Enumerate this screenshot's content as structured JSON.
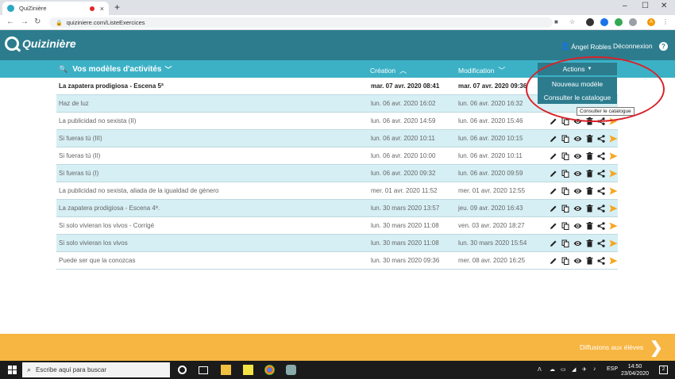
{
  "browser": {
    "tab_title": "QuiZinière",
    "tab_close": "×",
    "new_tab": "+",
    "window_controls": [
      "–",
      "☐",
      "✕"
    ],
    "url": "quiziniere.com/ListeExercices",
    "profile_initial": "A"
  },
  "app": {
    "logo_text": "Quizinière",
    "user_name": "Ángel Robles",
    "logout_label": "Déconnexion",
    "help_label": "?"
  },
  "table": {
    "title": "Vos modèles d'activités",
    "col_creation": "Création",
    "col_modification": "Modification",
    "actions_label": "Actions",
    "rows": [
      {
        "title": "La zapatera prodigiosa - Escena 5ª",
        "created": "mar. 07 avr. 2020 08:41",
        "modified": "mar. 07 avr. 2020 09:36"
      },
      {
        "title": "Haz de luz",
        "created": "lun. 06 avr. 2020 16:02",
        "modified": "lun. 06 avr. 2020 16:32"
      },
      {
        "title": "La publicidad no sexista (II)",
        "created": "lun. 06 avr. 2020 14:59",
        "modified": "lun. 06 avr. 2020 15:46"
      },
      {
        "title": "Si fueras tú (III)",
        "created": "lun. 06 avr. 2020 10:11",
        "modified": "lun. 06 avr. 2020 10:15"
      },
      {
        "title": "Si fueras tú (II)",
        "created": "lun. 06 avr. 2020 10:00",
        "modified": "lun. 06 avr. 2020 10:11"
      },
      {
        "title": "Si fueras tú (I)",
        "created": "lun. 06 avr. 2020 09:32",
        "modified": "lun. 06 avr. 2020 09:59"
      },
      {
        "title": "La publicidad no sexista, aliada de la igualdad de género",
        "created": "mer. 01 avr. 2020 11:52",
        "modified": "mer. 01 avr. 2020 12:55"
      },
      {
        "title": "La zapatera prodigiosa - Escena 4ª.",
        "created": "lun. 30 mars 2020 13:57",
        "modified": "jeu. 09 avr. 2020 16:43"
      },
      {
        "title": "Si solo vivieran los vivos - Corrigé",
        "created": "lun. 30 mars 2020 11:08",
        "modified": "ven. 03 avr. 2020 18:27"
      },
      {
        "title": "Si solo vivieran los vivos",
        "created": "lun. 30 mars 2020 11:08",
        "modified": "lun. 30 mars 2020 15:54"
      },
      {
        "title": "Puede ser que la conozcas",
        "created": "lun. 30 mars 2020 09:36",
        "modified": "mer. 08 avr. 2020 16:25"
      }
    ]
  },
  "dropdown": {
    "items": [
      "Nouveau modèle",
      "Consulter le catalogue"
    ],
    "tooltip": "Consulter le catalogue"
  },
  "footer": {
    "diffusions_label": "Diffusions aux élèves",
    "arrow": "❯"
  },
  "taskbar": {
    "search_placeholder": "Escribe aquí para buscar",
    "lang": "ESP",
    "time": "14:50",
    "date": "23/04/2020",
    "notifications": "2"
  },
  "colors": {
    "header": "#2c7c8e",
    "table_header": "#3cb1c6",
    "row_alt": "#d6eff4",
    "footer": "#f7b541",
    "share_icon": "#f5a623",
    "annotation": "#d8232a"
  }
}
